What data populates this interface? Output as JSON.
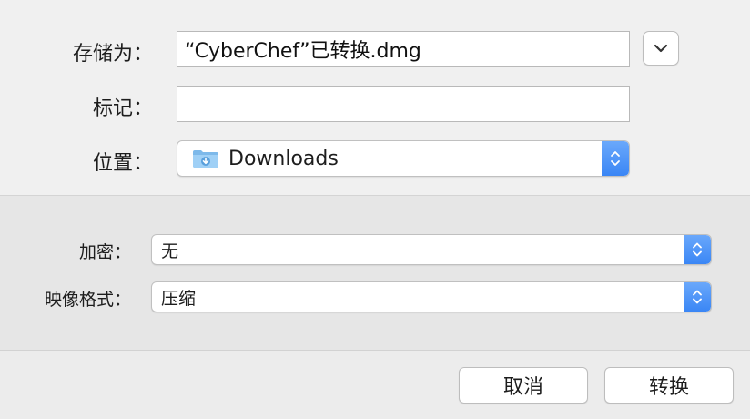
{
  "save_dialog": {
    "save_as_label": "存储为：",
    "save_as_value": "“CyberChef”已转换.dmg",
    "tags_label": "标记：",
    "tags_value": "",
    "location_label": "位置：",
    "location_value": "Downloads",
    "location_icon": "downloads-folder-icon",
    "expand_icon": "chevron-down-icon"
  },
  "options": {
    "encryption_label": "加密：",
    "encryption_value": "无",
    "image_format_label": "映像格式：",
    "image_format_value": "压缩"
  },
  "buttons": {
    "cancel_label": "取消",
    "convert_label": "转换"
  },
  "colors": {
    "accent_blue": "#3a86f5",
    "folder_blue": "#8cc4f1"
  }
}
